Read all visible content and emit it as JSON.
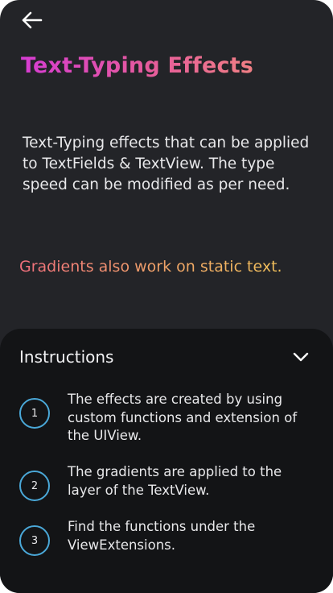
{
  "header": {
    "back_icon": "arrow-left-icon"
  },
  "main": {
    "title": "Text-Typing Effects",
    "description": "Text-Typing effects that can be applied to TextFields & TextView. The type speed can be modified as per need.",
    "gradient_note": "Gradients also work on static text."
  },
  "instructions": {
    "title": "Instructions",
    "toggle_icon": "chevron-down-icon",
    "steps": [
      {
        "number": "1",
        "text": "The effects are created by using custom functions and extension of the UIView."
      },
      {
        "number": "2",
        "text": "The gradients are applied to the layer of the TextView."
      },
      {
        "number": "3",
        "text": "Find the functions under the ViewExtensions."
      }
    ]
  },
  "colors": {
    "background": "#232428",
    "sheet": "#131416",
    "step_ring": "#4aa8d8",
    "title_gradient": [
      "#d63cd2",
      "#f07f84"
    ],
    "note_gradient": [
      "#f06e7c",
      "#f0c05a"
    ]
  }
}
